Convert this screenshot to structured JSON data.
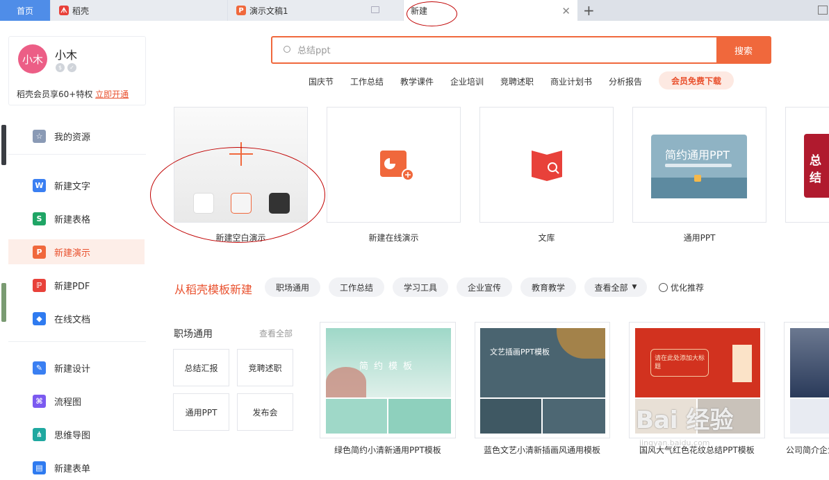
{
  "tabs": {
    "home": "首页",
    "daoke": "稻壳",
    "doc": "演示文稿1",
    "new": "新建"
  },
  "user": {
    "avatar_text": "小木",
    "name": "小木",
    "promo_text": "稻壳会员享60+特权",
    "promo_link": "立即开通"
  },
  "sidebar": {
    "items": [
      {
        "label": "我的资源",
        "icon": "star-icon",
        "color": "#8a9ab5"
      },
      {
        "label": "新建文字",
        "icon": "word-icon",
        "color": "#3a7ff2"
      },
      {
        "label": "新建表格",
        "icon": "sheet-icon",
        "color": "#1fa565"
      },
      {
        "label": "新建演示",
        "icon": "ppt-icon",
        "color": "#f0683c"
      },
      {
        "label": "新建PDF",
        "icon": "pdf-icon",
        "color": "#e8413a"
      },
      {
        "label": "在线文档",
        "icon": "cloud-doc-icon",
        "color": "#2f7bf0"
      },
      {
        "label": "新建设计",
        "icon": "design-icon",
        "color": "#3a7ff2"
      },
      {
        "label": "流程图",
        "icon": "flowchart-icon",
        "color": "#7b5af0"
      },
      {
        "label": "思维导图",
        "icon": "mindmap-icon",
        "color": "#1fa8a0"
      },
      {
        "label": "新建表单",
        "icon": "form-icon",
        "color": "#2f7bf0"
      }
    ]
  },
  "search": {
    "placeholder": "总结ppt",
    "button": "搜索",
    "hotwords": [
      "国庆节",
      "工作总结",
      "教学课件",
      "企业培训",
      "竞聘述职",
      "商业计划书",
      "分析报告"
    ],
    "vip_button": "会员免费下载"
  },
  "create_cards": [
    {
      "label": "新建空白演示"
    },
    {
      "label": "新建在线演示"
    },
    {
      "label": "文库"
    },
    {
      "label": "通用PPT",
      "thumb_text": "简约通用PPT"
    },
    {
      "thumb_text": "总结"
    }
  ],
  "templates": {
    "title": "从稻壳模板新建",
    "pills": [
      "职场通用",
      "工作总结",
      "学习工具",
      "企业宣传",
      "教育教学",
      "查看全部"
    ],
    "optimize": "优化推荐",
    "category_title": "职场通用",
    "category_all": "查看全部",
    "category_buttons": [
      "总结汇报",
      "竞聘述职",
      "通用PPT",
      "发布会"
    ],
    "cards": [
      {
        "label": "绿色简约小清新通用PPT模板",
        "thumb_text": "简约模板"
      },
      {
        "label": "蓝色文艺小清新插画风通用模板",
        "thumb_text": "文艺插画PPT模板"
      },
      {
        "label": "国风大气红色花纹总结PPT模板",
        "thumb_text": "请在此处添加大标题"
      },
      {
        "label": "公司简介企业"
      }
    ]
  },
  "watermark": {
    "main": "Bai 经验",
    "sub": "jingyan.baidu.com"
  }
}
